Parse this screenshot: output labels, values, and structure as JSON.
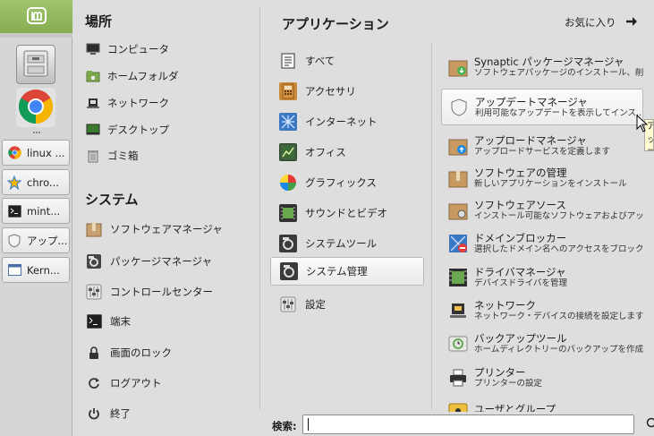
{
  "taskbar": {
    "launchers": [
      {
        "name": "files-launcher",
        "icon": "file-cabinet-icon"
      },
      {
        "name": "chrome-launcher",
        "icon": "chrome-icon"
      }
    ],
    "tasks": [
      {
        "label": "linux ...",
        "icon": "chrome-icon"
      },
      {
        "label": "chro...",
        "icon": "star-icon"
      },
      {
        "label": "mint...",
        "icon": "terminal-icon"
      },
      {
        "label": "アップ...",
        "icon": "shield-icon"
      },
      {
        "label": "Kern...",
        "icon": "window-icon"
      }
    ]
  },
  "places": {
    "title": "場所",
    "items": [
      {
        "label": "コンピュータ",
        "icon": "computer-icon"
      },
      {
        "label": "ホームフォルダ",
        "icon": "home-folder-icon"
      },
      {
        "label": "ネットワーク",
        "icon": "network-icon"
      },
      {
        "label": "デスクトップ",
        "icon": "desktop-icon"
      },
      {
        "label": "ゴミ箱",
        "icon": "trash-icon"
      }
    ]
  },
  "system": {
    "title": "システム",
    "items": [
      {
        "label": "ソフトウェアマネージャ",
        "icon": "software-manager-icon"
      },
      {
        "label": "パッケージマネージャ",
        "icon": "package-manager-icon"
      },
      {
        "label": "コントロールセンター",
        "icon": "control-center-icon"
      },
      {
        "label": "端末",
        "icon": "terminal-icon"
      },
      {
        "label": "画面のロック",
        "icon": "lock-icon"
      },
      {
        "label": "ログアウト",
        "icon": "logout-icon"
      },
      {
        "label": "終了",
        "icon": "power-icon"
      }
    ]
  },
  "applications": {
    "title": "アプリケーション",
    "favorites_label": "お気に入り",
    "categories": [
      {
        "label": "すべて",
        "icon": "all-icon"
      },
      {
        "label": "アクセサリ",
        "icon": "accessories-icon"
      },
      {
        "label": "インターネット",
        "icon": "internet-icon"
      },
      {
        "label": "オフィス",
        "icon": "office-icon"
      },
      {
        "label": "グラフィックス",
        "icon": "graphics-icon"
      },
      {
        "label": "サウンドとビデオ",
        "icon": "sound-video-icon"
      },
      {
        "label": "システムツール",
        "icon": "system-tools-icon"
      },
      {
        "label": "システム管理",
        "icon": "administration-icon",
        "selected": true
      },
      {
        "label": "設定",
        "icon": "settings-icon"
      }
    ],
    "apps": [
      {
        "name": "Synaptic パッケージマネージャ",
        "desc": "ソフトウェアパッケージのインストール、削...",
        "icon": "synaptic-icon"
      },
      {
        "name": "アップデートマネージャ",
        "desc": "利用可能なアップデートを表示してインス...",
        "icon": "update-manager-icon",
        "hover": true
      },
      {
        "name": "アップロードマネージャ",
        "desc": "アップロードサービスを定義します",
        "icon": "upload-manager-icon"
      },
      {
        "name": "ソフトウェアの管理",
        "desc": "新しいアプリケーションをインストール",
        "icon": "software-manager-icon"
      },
      {
        "name": "ソフトウェアソース",
        "desc": "インストール可能なソフトウェアおよびアッ...",
        "icon": "software-sources-icon"
      },
      {
        "name": "ドメインブロッカー",
        "desc": "選択したドメイン名へのアクセスをブロック",
        "icon": "domain-blocker-icon"
      },
      {
        "name": "ドライバマネージャ",
        "desc": "デバイスドライバを管理",
        "icon": "driver-manager-icon"
      },
      {
        "name": "ネットワーク",
        "desc": "ネットワーク・デバイスの接続を設定します",
        "icon": "network-icon"
      },
      {
        "name": "バックアップツール",
        "desc": "ホームディレクトリーのバックアップを作成...",
        "icon": "backup-icon"
      },
      {
        "name": "プリンター",
        "desc": "プリンターの設定",
        "icon": "printer-icon"
      },
      {
        "name": "ユーザとグループ",
        "desc": "",
        "icon": "users-groups-icon"
      }
    ]
  },
  "search": {
    "label": "検索:",
    "value": ""
  },
  "tooltip": {
    "text": "アップ 利用"
  },
  "colors": {
    "mint_green": "#87b158",
    "selection_bg": "#f2f2f2"
  }
}
